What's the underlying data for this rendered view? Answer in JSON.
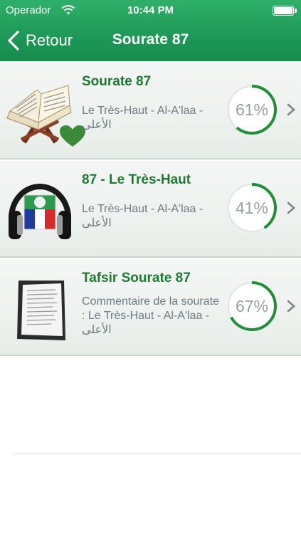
{
  "status": {
    "carrier": "Operador",
    "time": "10:44 PM"
  },
  "nav": {
    "back_label": "Retour",
    "title": "Sourate 87"
  },
  "items": [
    {
      "title": "Sourate 87",
      "subtitle": "Le Très-Haut - Al-A'laa - الأعلى",
      "progress_label": "61%",
      "progress": 0.61,
      "icon": "quran-book-icon",
      "favorite": true
    },
    {
      "title": "87 - Le Très-Haut",
      "subtitle": "Le Très-Haut - Al-A'laa - الأعلى",
      "progress_label": "41%",
      "progress": 0.41,
      "icon": "headphones-flag-icon",
      "favorite": true
    },
    {
      "title": "Tafsir Sourate 87",
      "subtitle": "Commentaire de la sourate : Le Très-Haut - Al-A'laa - الأعلى",
      "progress_label": "67%",
      "progress": 0.67,
      "icon": "clipboard-document-icon",
      "favorite": false
    }
  ],
  "colors": {
    "accent": "#1e9a56",
    "title_green": "#1e7a32",
    "progress_green": "#1f8f3a"
  }
}
